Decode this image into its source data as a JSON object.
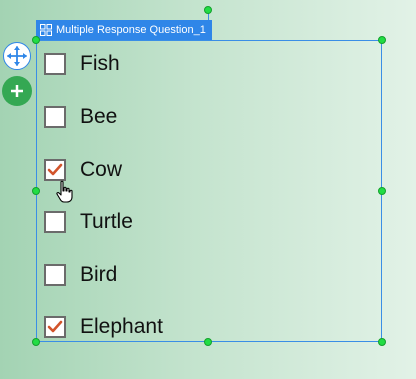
{
  "question": {
    "title": "Multiple Response Question_1",
    "options": [
      {
        "label": "Fish",
        "checked": false
      },
      {
        "label": "Bee",
        "checked": false
      },
      {
        "label": "Cow",
        "checked": true
      },
      {
        "label": "Turtle",
        "checked": false
      },
      {
        "label": "Bird",
        "checked": false
      },
      {
        "label": "Elephant",
        "checked": true
      }
    ]
  },
  "colors": {
    "selection": "#3a8ee6",
    "handle": "#22dd44",
    "check": "#d2542b",
    "add_button": "#34a853"
  },
  "icons": {
    "title": "grid-icon",
    "move": "move-arrows-icon",
    "add": "plus-icon",
    "cursor": "hand-pointer-icon"
  }
}
